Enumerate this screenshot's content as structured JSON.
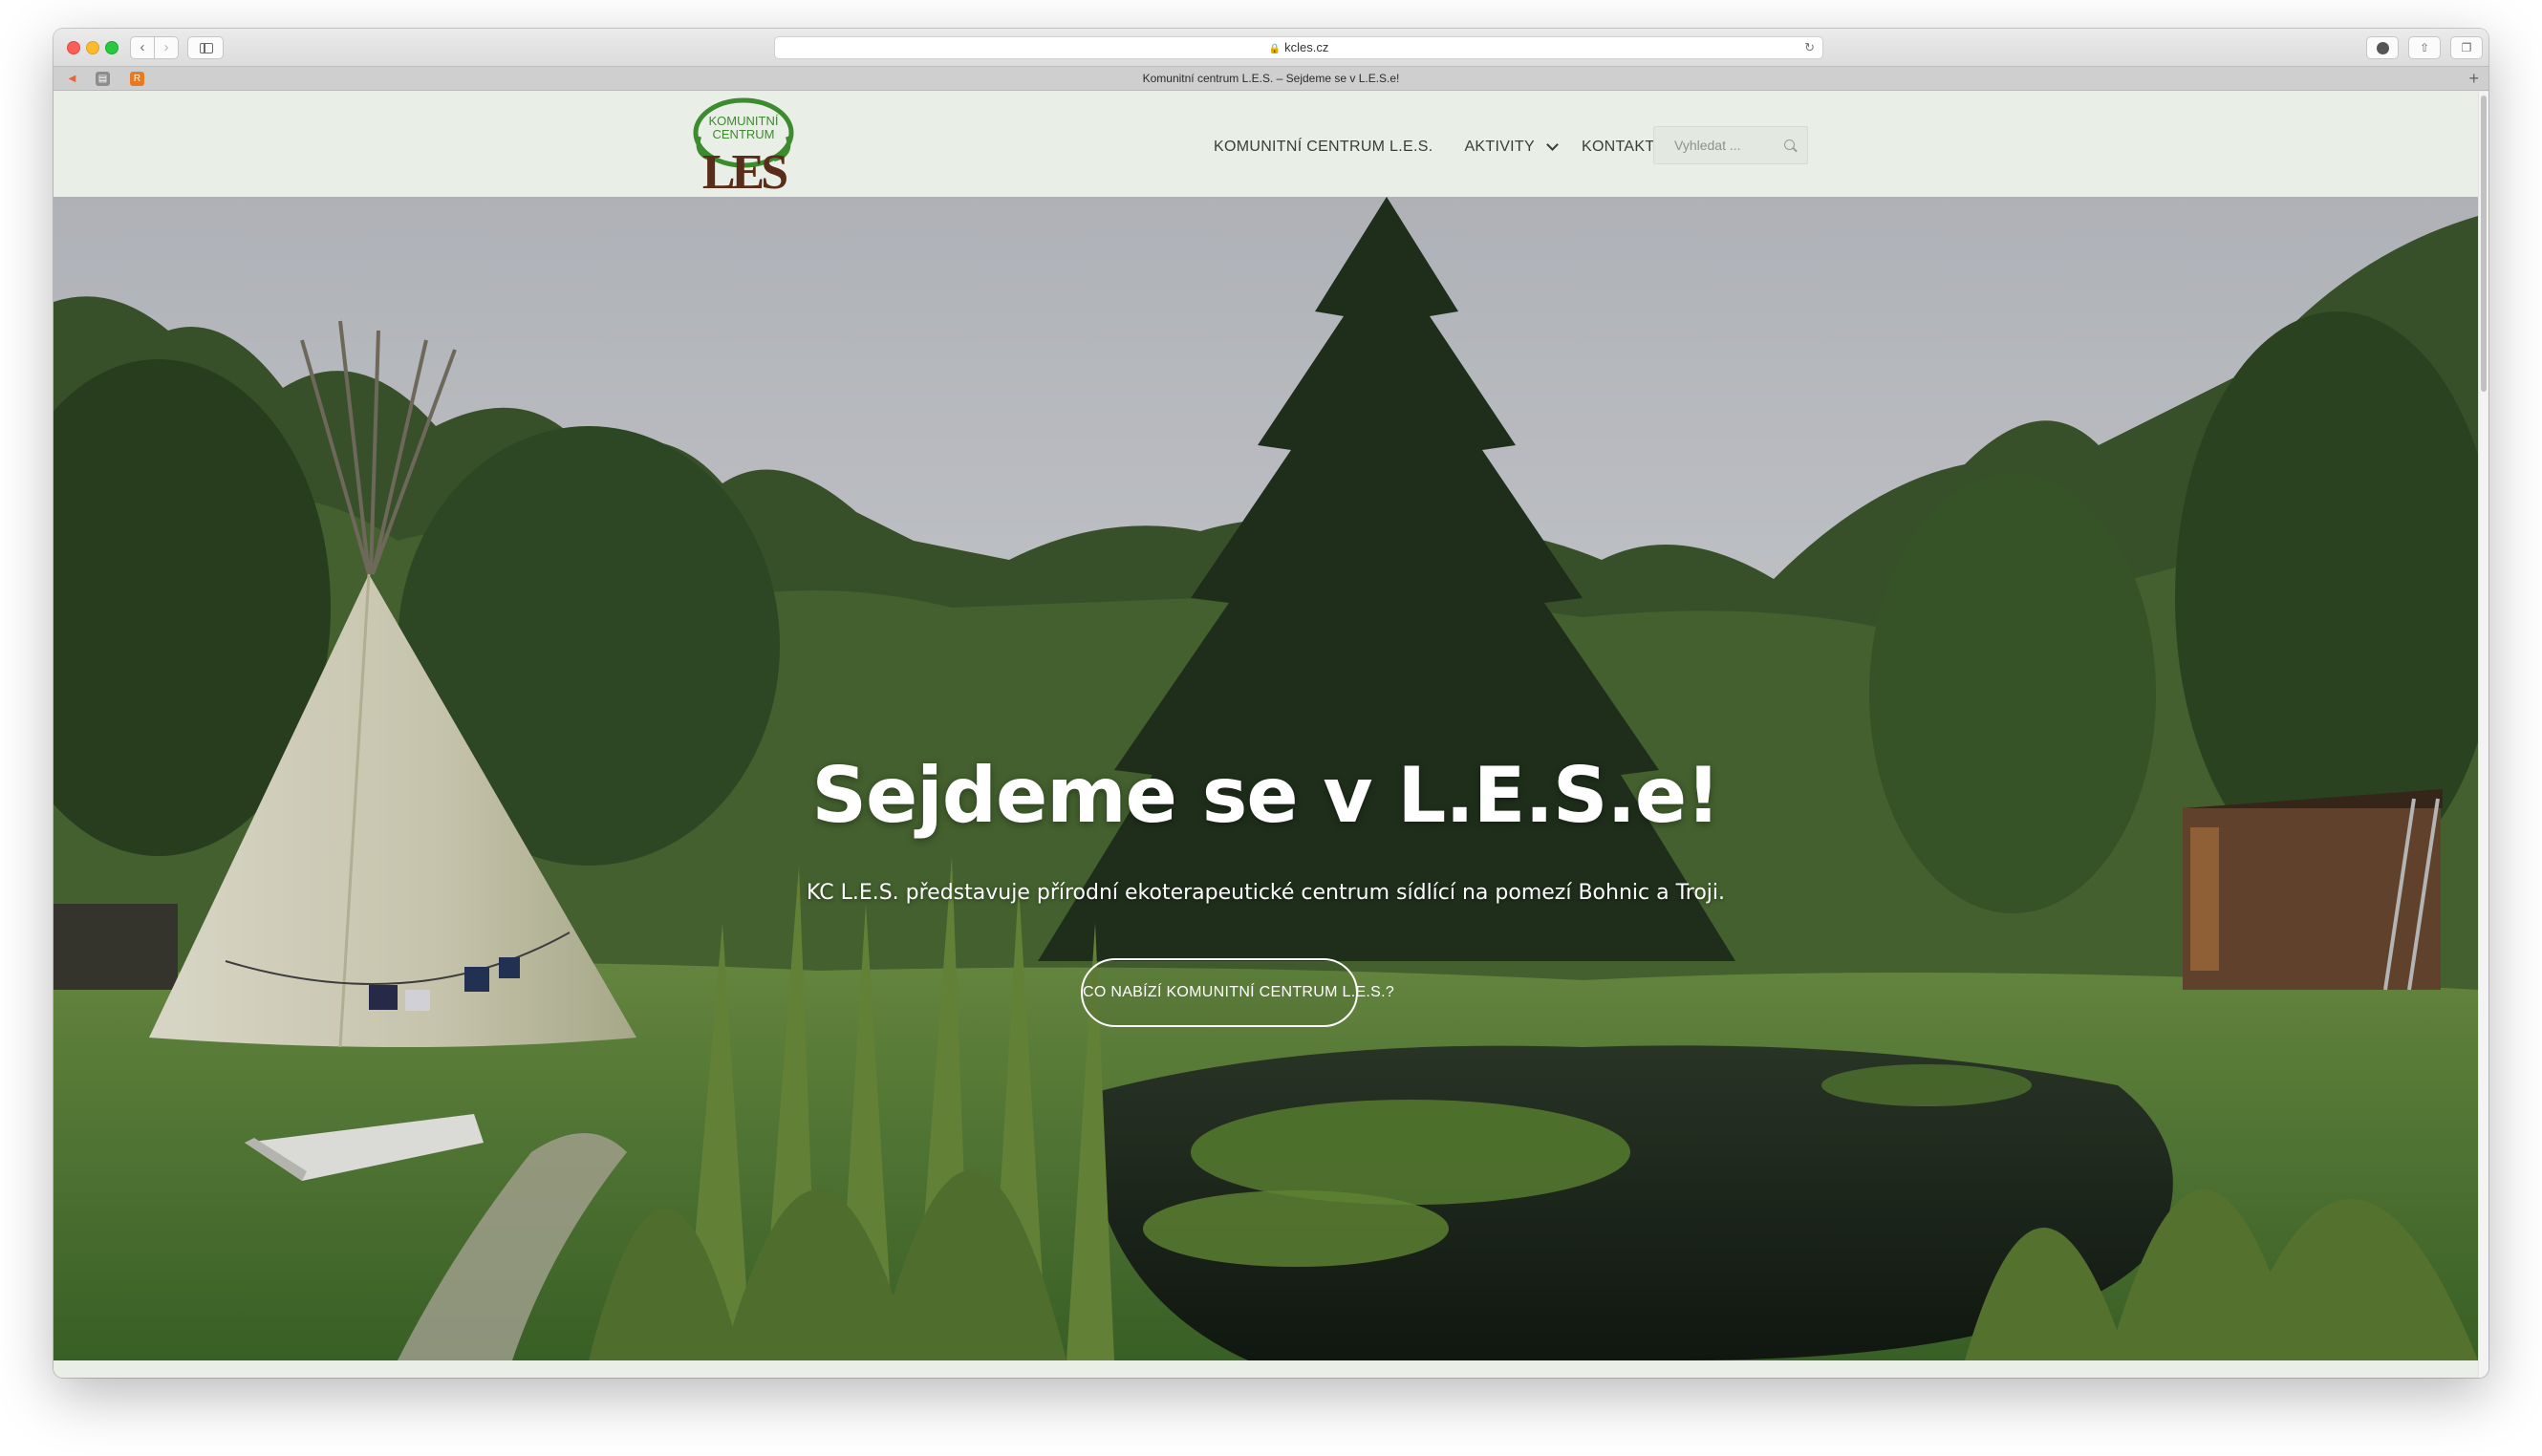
{
  "browser": {
    "url": "kcles.cz",
    "tab_title": "Komunitní centrum L.E.S. – Sejdeme se v L.E.S.e!",
    "icons": {
      "back": "chevron-left-icon",
      "forward": "chevron-right-icon",
      "sidebar": "sidebar-icon",
      "lock": "lock-icon",
      "reload": "reload-icon",
      "downloads": "download-icon",
      "share": "share-icon",
      "tabs": "tabs-icon",
      "new_tab": "plus-icon"
    }
  },
  "site": {
    "logo": {
      "line1": "KOMUNITNÍ",
      "line2": "CENTRUM",
      "mark": "LES"
    },
    "nav": {
      "home": "KOMUNITNÍ CENTRUM L.E.S.",
      "activities": "AKTIVITY",
      "contact": "KONTAKT"
    },
    "search": {
      "placeholder": "Vyhledat ..."
    },
    "colors": {
      "header_bg": "#e9eee6",
      "logo_green": "#3d8b2f",
      "logo_brown": "#5a2d1a"
    }
  },
  "hero": {
    "title": "Sejdeme se v L.E.S.e!",
    "subtitle": "KC L.E.S. představuje přírodní ekoterapeutické centrum sídlící na pomezí Bohnic a Troji.",
    "cta": "CO NABÍZÍ KOMUNITNÍ CENTRUM L.E.S.?"
  }
}
